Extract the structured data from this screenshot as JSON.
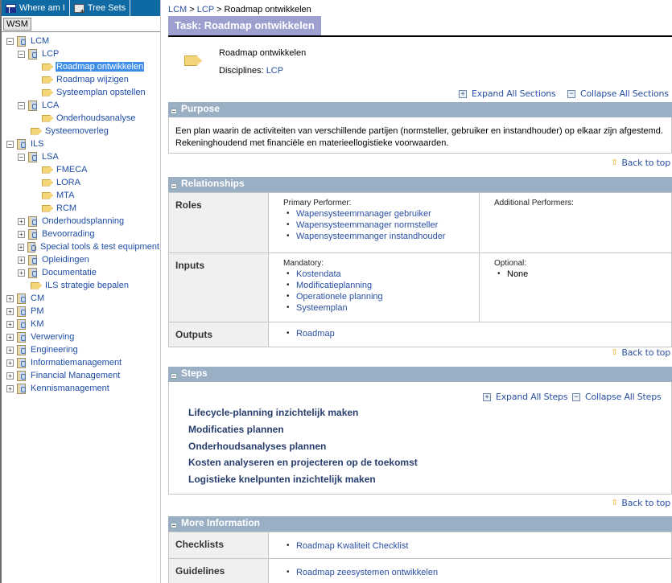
{
  "left": {
    "tabs": [
      {
        "label": "Where am I",
        "icon": "where-am-i-icon"
      },
      {
        "label": "Tree Sets",
        "icon": "tree-sets-icon"
      }
    ],
    "view_tab": "WSM",
    "tree": [
      {
        "label": "LCM",
        "level": 0,
        "toggle": "minus",
        "type": "book"
      },
      {
        "label": "LCP",
        "level": 1,
        "toggle": "minus",
        "type": "book"
      },
      {
        "label": "Roadmap ontwikkelen",
        "level": 2,
        "toggle": "none",
        "type": "task",
        "selected": true
      },
      {
        "label": "Roadmap wijzigen",
        "level": 2,
        "toggle": "none",
        "type": "task"
      },
      {
        "label": "Systeemplan opstellen",
        "level": 2,
        "toggle": "none",
        "type": "task"
      },
      {
        "label": "LCA",
        "level": 1,
        "toggle": "minus",
        "type": "book"
      },
      {
        "label": "Onderhoudsanalyse",
        "level": 2,
        "toggle": "none",
        "type": "task"
      },
      {
        "label": "Systeemoverleg",
        "level": 1,
        "toggle": "none",
        "type": "task"
      },
      {
        "label": "ILS",
        "level": 0,
        "toggle": "minus",
        "type": "book"
      },
      {
        "label": "LSA",
        "level": 1,
        "toggle": "minus",
        "type": "book"
      },
      {
        "label": "FMECA",
        "level": 2,
        "toggle": "none",
        "type": "task"
      },
      {
        "label": "LORA",
        "level": 2,
        "toggle": "none",
        "type": "task"
      },
      {
        "label": "MTA",
        "level": 2,
        "toggle": "none",
        "type": "task"
      },
      {
        "label": "RCM",
        "level": 2,
        "toggle": "none",
        "type": "task"
      },
      {
        "label": "Onderhoudsplanning",
        "level": 1,
        "toggle": "plus",
        "type": "book"
      },
      {
        "label": "Bevoorrading",
        "level": 1,
        "toggle": "plus",
        "type": "book"
      },
      {
        "label": "Special tools & test equipment",
        "level": 1,
        "toggle": "plus",
        "type": "book"
      },
      {
        "label": "Opleidingen",
        "level": 1,
        "toggle": "plus",
        "type": "book"
      },
      {
        "label": "Documentatie",
        "level": 1,
        "toggle": "plus",
        "type": "book"
      },
      {
        "label": "ILS strategie bepalen",
        "level": 1,
        "toggle": "none",
        "type": "task"
      },
      {
        "label": "CM",
        "level": 0,
        "toggle": "plus",
        "type": "book"
      },
      {
        "label": "PM",
        "level": 0,
        "toggle": "plus",
        "type": "book"
      },
      {
        "label": "KM",
        "level": 0,
        "toggle": "plus",
        "type": "book"
      },
      {
        "label": "Verwerving",
        "level": 0,
        "toggle": "plus",
        "type": "book"
      },
      {
        "label": "Engineering",
        "level": 0,
        "toggle": "plus",
        "type": "book"
      },
      {
        "label": "Informatiemanagement",
        "level": 0,
        "toggle": "plus",
        "type": "book"
      },
      {
        "label": "Financial Management",
        "level": 0,
        "toggle": "plus",
        "type": "book"
      },
      {
        "label": "Kennismanagement",
        "level": 0,
        "toggle": "plus",
        "type": "book"
      }
    ]
  },
  "page": {
    "breadcrumb": [
      "LCM",
      "LCP",
      "Roadmap ontwikkelen"
    ],
    "breadcrumb_sep": " > ",
    "title": "Task: Roadmap ontwikkelen",
    "task_name": "Roadmap ontwikkelen",
    "disciplines_label": "Disciplines: ",
    "disciplines_value": "LCP",
    "expand_all_sections": "Expand All Sections",
    "collapse_all_sections": "Collapse All Sections",
    "back_to_top": "Back to top"
  },
  "purpose": {
    "heading": "Purpose",
    "text_line1": "Een plan waarin de activiteiten van verschillende partijen (normsteller, gebruiker en instandhouder) op elkaar zijn afgestemd.",
    "text_line2": "Rekeninghoudend met financiële en materieellogistieke voorwaarden."
  },
  "relationships": {
    "heading": "Relationships",
    "roles": {
      "label": "Roles",
      "primary_label": "Primary Performer:",
      "primary": [
        "Wapensysteemmanager gebruiker",
        "Wapensysteemmanager normsteller",
        "Wapensysteemmanger instandhouder"
      ],
      "additional_label": "Additional Performers:"
    },
    "inputs": {
      "label": "Inputs",
      "mandatory_label": "Mandatory:",
      "mandatory": [
        "Kostendata",
        "Modificatieplanning",
        "Operationele planning",
        "Systeemplan"
      ],
      "optional_label": "Optional:",
      "optional": [
        "None"
      ]
    },
    "outputs": {
      "label": "Outputs",
      "items": [
        "Roadmap"
      ]
    }
  },
  "steps": {
    "heading": "Steps",
    "expand_all": "Expand All Steps",
    "collapse_all": "Collapse All Steps",
    "items": [
      "Lifecycle-planning inzichtelijk maken",
      "Modificaties plannen",
      "Onderhoudsanalyses plannen",
      "Kosten analyseren en projecteren op de toekomst",
      "Logistieke knelpunten inzichtelijk maken"
    ]
  },
  "more_info": {
    "heading": "More Information",
    "checklists_label": "Checklists",
    "checklists": [
      "Roadmap Kwaliteit Checklist"
    ],
    "guidelines_label": "Guidelines",
    "guidelines": [
      "Roadmap zeesystemen ontwikkelen"
    ]
  },
  "colors": {
    "left_header": "#0f6aa3",
    "title_bar": "#9d9fcf",
    "section_header": "#9aaec4",
    "link": "#2a4fa3",
    "selected": "#3f8ee8"
  }
}
